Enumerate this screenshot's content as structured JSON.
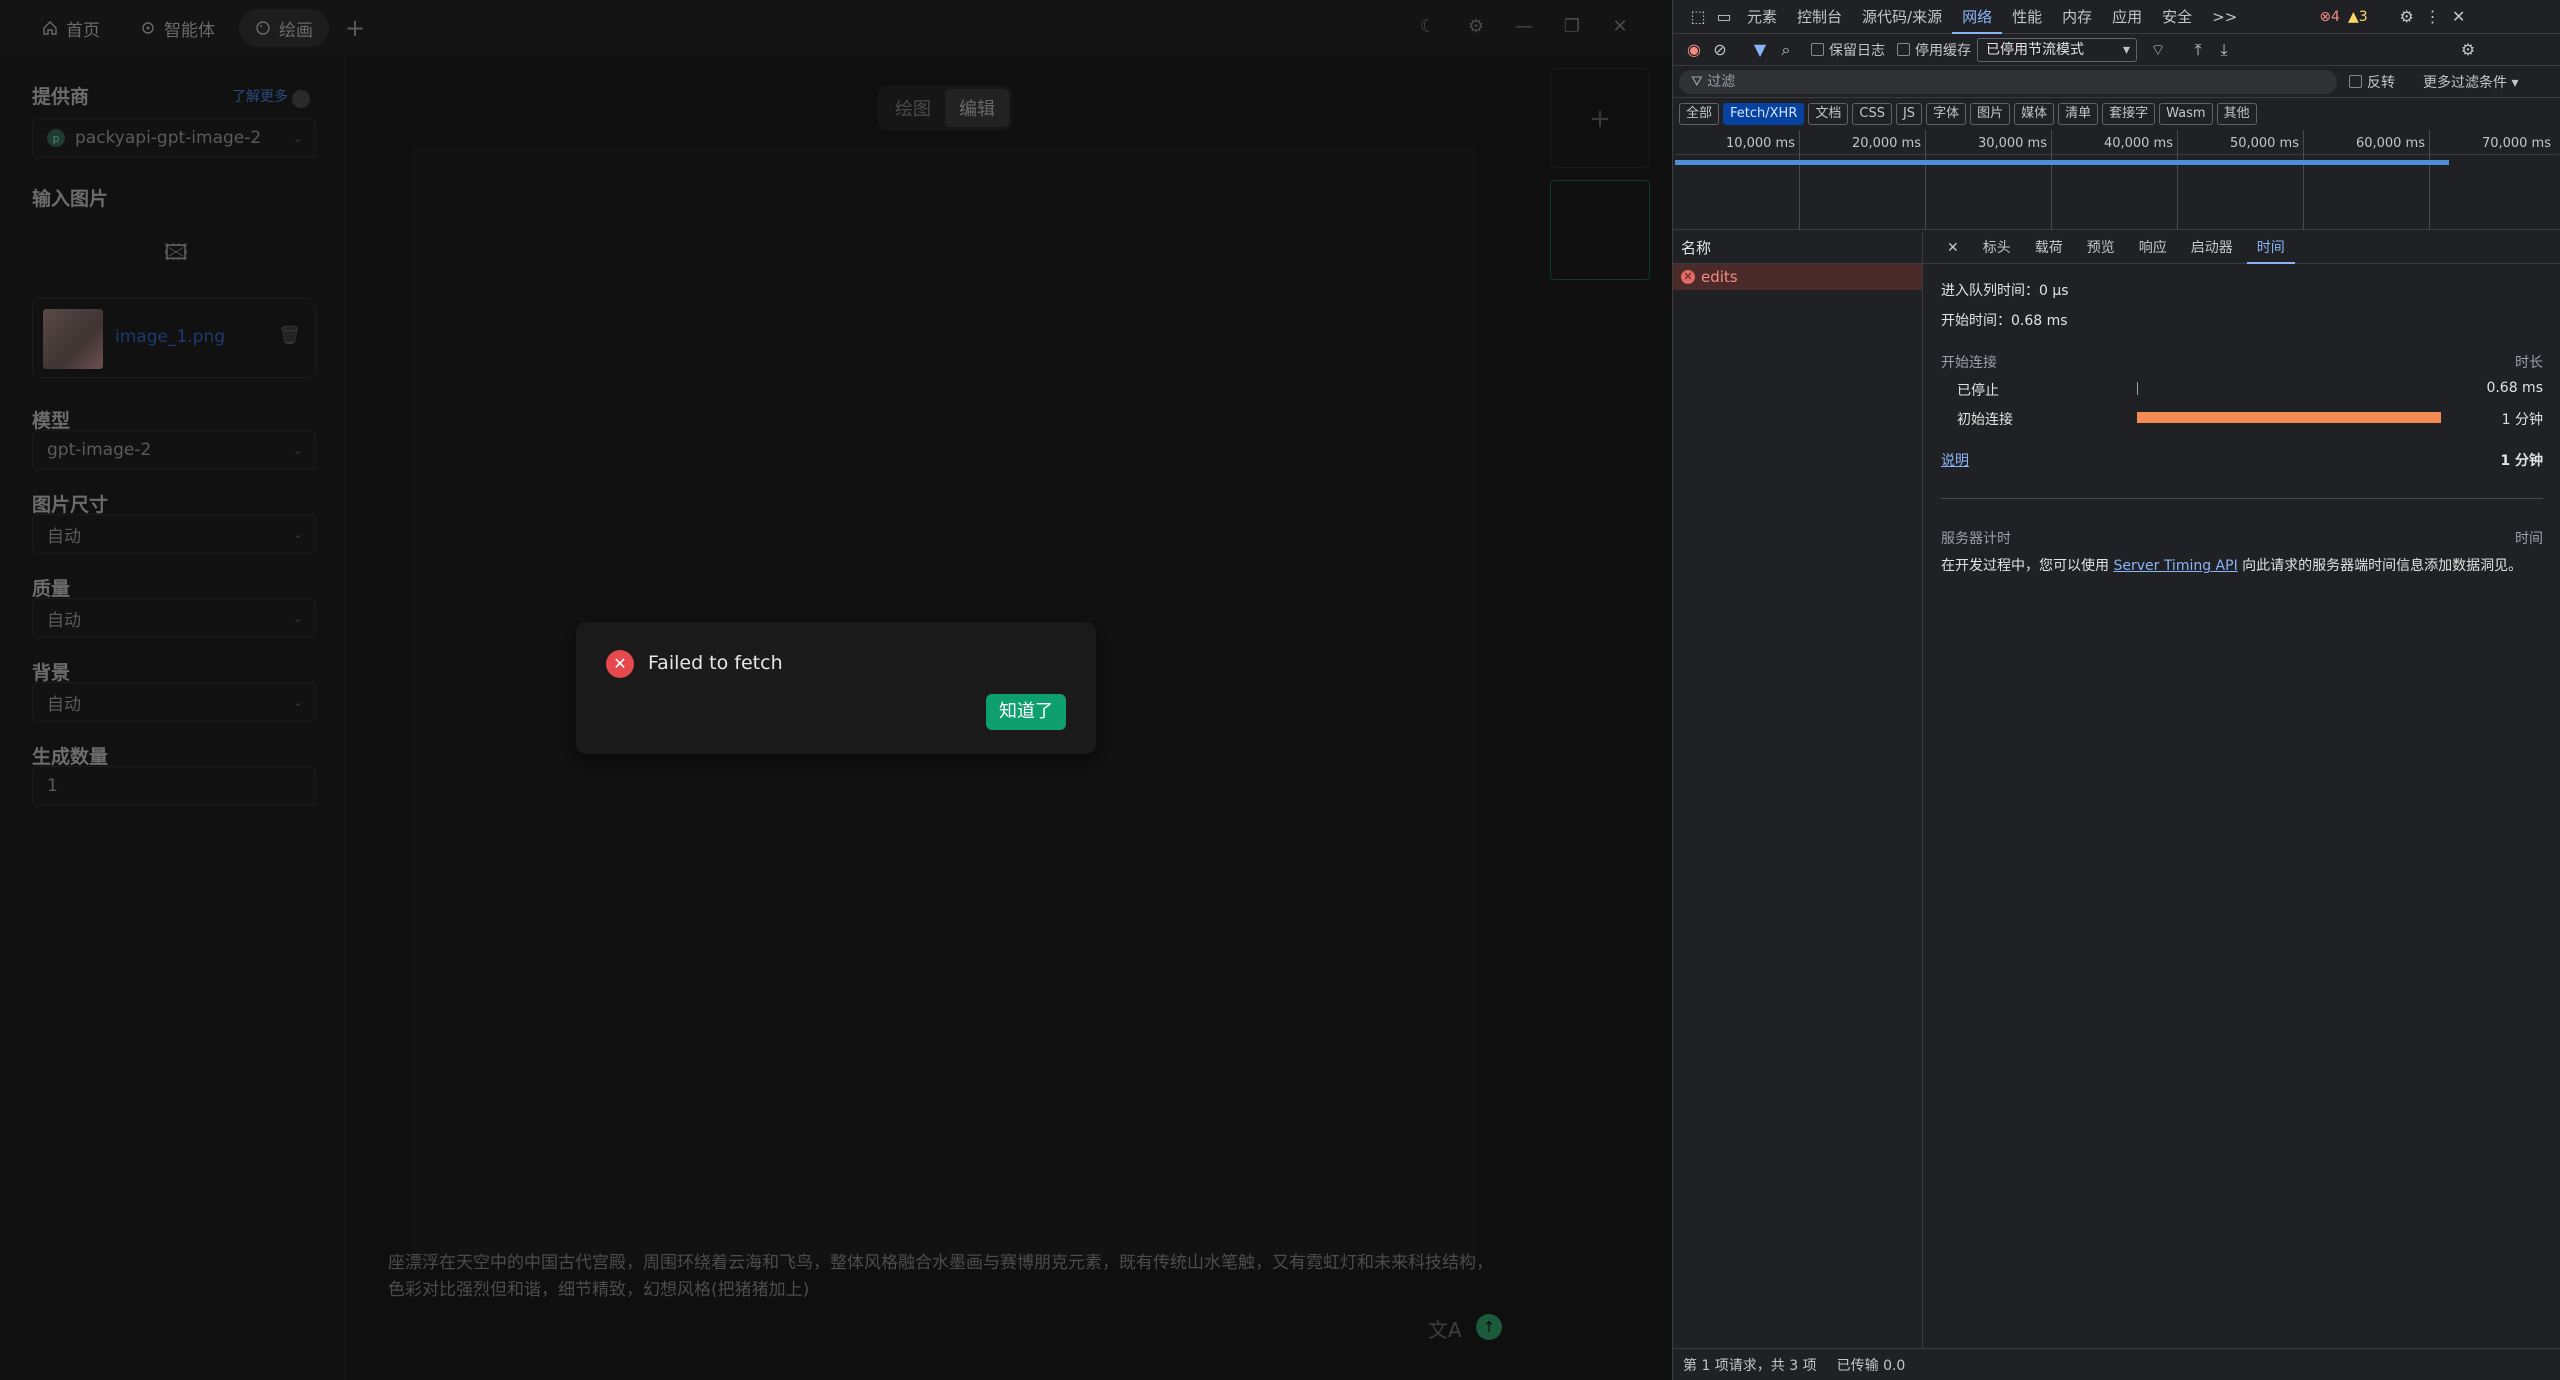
{
  "app": {
    "tabs": [
      {
        "label": "首页",
        "icon": "home-icon"
      },
      {
        "label": "智能体",
        "icon": "agent-icon"
      },
      {
        "label": "绘画",
        "icon": "palette-icon"
      }
    ],
    "add_tab": "+"
  },
  "sidebar": {
    "provider_label": "提供商",
    "learn_more": "了解更多",
    "provider_value": "packyapi-gpt-image-2",
    "provider_badge": "p",
    "input_image_label": "输入图片",
    "image_file": "image_1.png",
    "model_label": "模型",
    "model_value": "gpt-image-2",
    "size_label": "图片尺寸",
    "size_value": "自动",
    "quality_label": "质量",
    "quality_value": "自动",
    "background_label": "背景",
    "background_value": "自动",
    "count_label": "生成数量",
    "count_value": "1"
  },
  "main": {
    "mode_tabs": [
      "绘图",
      "编辑"
    ],
    "active_mode": "编辑",
    "prompt": "座漂浮在天空中的中国古代宫殿，周围环绕着云海和飞鸟，整体风格融合水墨画与赛博朋克元素，既有传统山水笔触，又有霓虹灯和未来科技结构，色彩对比强烈但和谐，细节精致，幻想风格(把猪猪加上)"
  },
  "dialog": {
    "message": "Failed to fetch",
    "ok_label": "知道了"
  },
  "devtools": {
    "tabs": [
      "元素",
      "控制台",
      "源代码/来源",
      "网络",
      "性能",
      "内存",
      "应用",
      "安全"
    ],
    "active_tab": "网络",
    "more": ">>",
    "errors": "4",
    "warnings": "3",
    "preserve_log": "保留日志",
    "disable_cache": "停用缓存",
    "throttle": "已停用节流模式",
    "filter_placeholder": "过滤",
    "invert": "反转",
    "more_filters": "更多过滤条件",
    "type_filters": [
      "全部",
      "Fetch/XHR",
      "文档",
      "CSS",
      "JS",
      "字体",
      "图片",
      "媒体",
      "清单",
      "套接字",
      "Wasm",
      "其他"
    ],
    "active_type": "Fetch/XHR",
    "timeline_ticks": [
      "10,000 ms",
      "20,000 ms",
      "30,000 ms",
      "40,000 ms",
      "50,000 ms",
      "60,000 ms",
      "70,000 ms"
    ],
    "name_header": "名称",
    "requests": [
      {
        "name": "edits",
        "status": "error"
      }
    ],
    "detail_tabs": [
      "标头",
      "载荷",
      "预览",
      "响应",
      "启动器",
      "时间"
    ],
    "active_detail": "时间",
    "queued": "进入队列时间：0 μs",
    "started": "开始时间：0.68 ms",
    "connection_header": "开始连接",
    "duration_header": "时长",
    "rows": [
      {
        "label": "已停止",
        "value": "0.68 ms"
      },
      {
        "label": "初始连接",
        "value": "1 分钟"
      }
    ],
    "explain": "说明",
    "total": "1 分钟",
    "server_timing_header": "服务器计时",
    "time_header": "时间",
    "server_text_1": "在开发过程中，您可以使用",
    "server_link": "Server Timing API",
    "server_text_2": "向此请求的服务器端时间信息添加数据洞见。",
    "status_requests": "第 1 项请求，共 3 项",
    "status_transfer": "已传输 0.0"
  },
  "colors": {
    "accent": "#0e9f6e",
    "error": "#e5484d",
    "timing_bar": "#f28b54",
    "devtools_link": "#8ab4f8"
  }
}
